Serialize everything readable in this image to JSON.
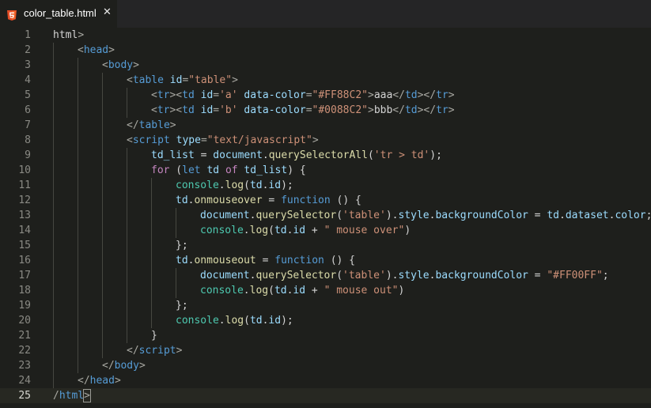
{
  "tab": {
    "title": "color_table.html",
    "close_glyph": "✕",
    "icon": "html5-icon"
  },
  "colors": {
    "background": "#1e1f1c",
    "active_line": "#272822",
    "tag": "#569cd6",
    "attribute": "#9cdcfe",
    "string": "#ce9178",
    "keyword": "#c586c0"
  },
  "editor": {
    "active_line": 25,
    "lines": [
      {
        "n": "1",
        "indent": 0,
        "tokens": [
          [
            "plain",
            "html"
          ],
          [
            "punc",
            ">"
          ]
        ]
      },
      {
        "n": "2",
        "indent": 1,
        "tokens": [
          [
            "punc",
            "<"
          ],
          [
            "tag",
            "head"
          ],
          [
            "punc",
            ">"
          ]
        ]
      },
      {
        "n": "3",
        "indent": 2,
        "tokens": [
          [
            "punc",
            "<"
          ],
          [
            "tag",
            "body"
          ],
          [
            "punc",
            ">"
          ]
        ]
      },
      {
        "n": "4",
        "indent": 3,
        "tokens": [
          [
            "punc",
            "<"
          ],
          [
            "tag",
            "table"
          ],
          [
            "plain",
            " "
          ],
          [
            "attr",
            "id"
          ],
          [
            "punc",
            "="
          ],
          [
            "str",
            "\"table\""
          ],
          [
            "punc",
            ">"
          ]
        ]
      },
      {
        "n": "5",
        "indent": 4,
        "tokens": [
          [
            "punc",
            "<"
          ],
          [
            "tag",
            "tr"
          ],
          [
            "punc",
            "><"
          ],
          [
            "tag",
            "td"
          ],
          [
            "plain",
            " "
          ],
          [
            "attr",
            "id"
          ],
          [
            "punc",
            "="
          ],
          [
            "str",
            "'a'"
          ],
          [
            "plain",
            " "
          ],
          [
            "attr",
            "data-color"
          ],
          [
            "punc",
            "="
          ],
          [
            "str",
            "\"#FF88C2\""
          ],
          [
            "punc",
            ">"
          ],
          [
            "plain",
            "aaa"
          ],
          [
            "punc",
            "</"
          ],
          [
            "tag",
            "td"
          ],
          [
            "punc",
            "></"
          ],
          [
            "tag",
            "tr"
          ],
          [
            "punc",
            ">"
          ]
        ]
      },
      {
        "n": "6",
        "indent": 4,
        "tokens": [
          [
            "punc",
            "<"
          ],
          [
            "tag",
            "tr"
          ],
          [
            "punc",
            "><"
          ],
          [
            "tag",
            "td"
          ],
          [
            "plain",
            " "
          ],
          [
            "attr",
            "id"
          ],
          [
            "punc",
            "="
          ],
          [
            "str",
            "'b'"
          ],
          [
            "plain",
            " "
          ],
          [
            "attr",
            "data-color"
          ],
          [
            "punc",
            "="
          ],
          [
            "str",
            "\"#0088C2\""
          ],
          [
            "punc",
            ">"
          ],
          [
            "plain",
            "bbb"
          ],
          [
            "punc",
            "</"
          ],
          [
            "tag",
            "td"
          ],
          [
            "punc",
            "></"
          ],
          [
            "tag",
            "tr"
          ],
          [
            "punc",
            ">"
          ]
        ]
      },
      {
        "n": "7",
        "indent": 3,
        "tokens": [
          [
            "punc",
            "</"
          ],
          [
            "tag",
            "table"
          ],
          [
            "punc",
            ">"
          ]
        ]
      },
      {
        "n": "8",
        "indent": 3,
        "tokens": [
          [
            "punc",
            "<"
          ],
          [
            "tag",
            "script"
          ],
          [
            "plain",
            " "
          ],
          [
            "attr",
            "type"
          ],
          [
            "punc",
            "="
          ],
          [
            "str",
            "\"text/javascript\""
          ],
          [
            "punc",
            ">"
          ]
        ]
      },
      {
        "n": "9",
        "indent": 4,
        "tokens": [
          [
            "var",
            "td_list"
          ],
          [
            "plain",
            " = "
          ],
          [
            "var",
            "document"
          ],
          [
            "plain",
            "."
          ],
          [
            "fn",
            "querySelectorAll"
          ],
          [
            "plain",
            "("
          ],
          [
            "str",
            "'tr > td'"
          ],
          [
            "plain",
            ");"
          ]
        ]
      },
      {
        "n": "10",
        "indent": 4,
        "tokens": [
          [
            "kw",
            "for"
          ],
          [
            "plain",
            " ("
          ],
          [
            "stg",
            "let"
          ],
          [
            "plain",
            " "
          ],
          [
            "var",
            "td"
          ],
          [
            "plain",
            " "
          ],
          [
            "kw",
            "of"
          ],
          [
            "plain",
            " "
          ],
          [
            "var",
            "td_list"
          ],
          [
            "plain",
            ") {"
          ]
        ]
      },
      {
        "n": "11",
        "indent": 5,
        "tokens": [
          [
            "cls",
            "console"
          ],
          [
            "plain",
            "."
          ],
          [
            "fn",
            "log"
          ],
          [
            "plain",
            "("
          ],
          [
            "var",
            "td"
          ],
          [
            "plain",
            "."
          ],
          [
            "var",
            "id"
          ],
          [
            "plain",
            ");"
          ]
        ]
      },
      {
        "n": "12",
        "indent": 5,
        "tokens": [
          [
            "var",
            "td"
          ],
          [
            "plain",
            "."
          ],
          [
            "fn",
            "onmouseover"
          ],
          [
            "plain",
            " = "
          ],
          [
            "stg",
            "function"
          ],
          [
            "plain",
            " () {"
          ]
        ]
      },
      {
        "n": "13",
        "indent": 6,
        "tokens": [
          [
            "var",
            "document"
          ],
          [
            "plain",
            "."
          ],
          [
            "fn",
            "querySelector"
          ],
          [
            "plain",
            "("
          ],
          [
            "str",
            "'table'"
          ],
          [
            "plain",
            ")."
          ],
          [
            "var",
            "style"
          ],
          [
            "plain",
            "."
          ],
          [
            "var",
            "backgroundColor"
          ],
          [
            "plain",
            " = "
          ],
          [
            "var",
            "td"
          ],
          [
            "plain",
            "."
          ],
          [
            "var",
            "dataset"
          ],
          [
            "plain",
            "."
          ],
          [
            "var",
            "color"
          ],
          [
            "plain",
            ";"
          ]
        ]
      },
      {
        "n": "14",
        "indent": 6,
        "tokens": [
          [
            "cls",
            "console"
          ],
          [
            "plain",
            "."
          ],
          [
            "fn",
            "log"
          ],
          [
            "plain",
            "("
          ],
          [
            "var",
            "td"
          ],
          [
            "plain",
            "."
          ],
          [
            "var",
            "id"
          ],
          [
            "plain",
            " + "
          ],
          [
            "str",
            "\" mouse over\""
          ],
          [
            "plain",
            ")"
          ]
        ]
      },
      {
        "n": "15",
        "indent": 5,
        "tokens": [
          [
            "plain",
            "};"
          ]
        ]
      },
      {
        "n": "16",
        "indent": 5,
        "tokens": [
          [
            "var",
            "td"
          ],
          [
            "plain",
            "."
          ],
          [
            "fn",
            "onmouseout"
          ],
          [
            "plain",
            " = "
          ],
          [
            "stg",
            "function"
          ],
          [
            "plain",
            " () {"
          ]
        ]
      },
      {
        "n": "17",
        "indent": 6,
        "tokens": [
          [
            "var",
            "document"
          ],
          [
            "plain",
            "."
          ],
          [
            "fn",
            "querySelector"
          ],
          [
            "plain",
            "("
          ],
          [
            "str",
            "'table'"
          ],
          [
            "plain",
            ")."
          ],
          [
            "var",
            "style"
          ],
          [
            "plain",
            "."
          ],
          [
            "var",
            "backgroundColor"
          ],
          [
            "plain",
            " = "
          ],
          [
            "str",
            "\"#FF00FF\""
          ],
          [
            "plain",
            ";"
          ]
        ]
      },
      {
        "n": "18",
        "indent": 6,
        "tokens": [
          [
            "cls",
            "console"
          ],
          [
            "plain",
            "."
          ],
          [
            "fn",
            "log"
          ],
          [
            "plain",
            "("
          ],
          [
            "var",
            "td"
          ],
          [
            "plain",
            "."
          ],
          [
            "var",
            "id"
          ],
          [
            "plain",
            " + "
          ],
          [
            "str",
            "\" mouse out\""
          ],
          [
            "plain",
            ")"
          ]
        ]
      },
      {
        "n": "19",
        "indent": 5,
        "tokens": [
          [
            "plain",
            "};"
          ]
        ]
      },
      {
        "n": "20",
        "indent": 5,
        "tokens": [
          [
            "cls",
            "console"
          ],
          [
            "plain",
            "."
          ],
          [
            "fn",
            "log"
          ],
          [
            "plain",
            "("
          ],
          [
            "var",
            "td"
          ],
          [
            "plain",
            "."
          ],
          [
            "var",
            "id"
          ],
          [
            "plain",
            ");"
          ]
        ]
      },
      {
        "n": "21",
        "indent": 4,
        "tokens": [
          [
            "plain",
            "}"
          ]
        ]
      },
      {
        "n": "22",
        "indent": 3,
        "tokens": [
          [
            "punc",
            "</"
          ],
          [
            "tag",
            "script"
          ],
          [
            "punc",
            ">"
          ]
        ]
      },
      {
        "n": "23",
        "indent": 2,
        "tokens": [
          [
            "punc",
            "</"
          ],
          [
            "tag",
            "body"
          ],
          [
            "punc",
            ">"
          ]
        ]
      },
      {
        "n": "24",
        "indent": 1,
        "tokens": [
          [
            "punc",
            "</"
          ],
          [
            "tag",
            "head"
          ],
          [
            "punc",
            ">"
          ]
        ]
      },
      {
        "n": "25",
        "indent": 0,
        "tokens": [
          [
            "punc",
            "/"
          ],
          [
            "tag",
            "html"
          ],
          [
            "punc",
            ">"
          ]
        ]
      }
    ]
  }
}
